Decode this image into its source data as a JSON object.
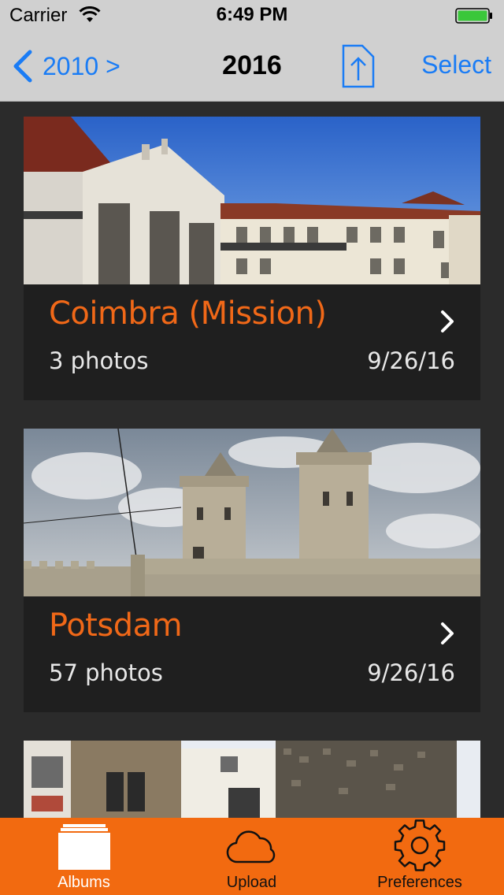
{
  "status_bar": {
    "carrier": "Carrier",
    "time": "6:49 PM"
  },
  "nav": {
    "back_label": "2010 >",
    "title": "2016",
    "select_label": "Select",
    "accent_color": "#1a7cf5"
  },
  "albums": [
    {
      "title": "Coimbra (Mission)",
      "count": "3 photos",
      "date": "9/26/16"
    },
    {
      "title": "Potsdam",
      "count": "57 photos",
      "date": "9/26/16"
    }
  ],
  "tab_bar": {
    "color": "#f26a10",
    "tabs": [
      {
        "label": "Albums",
        "icon": "albums-icon",
        "active": true
      },
      {
        "label": "Upload",
        "icon": "cloud-icon",
        "active": false
      },
      {
        "label": "Preferences",
        "icon": "gear-icon",
        "active": false
      }
    ]
  }
}
